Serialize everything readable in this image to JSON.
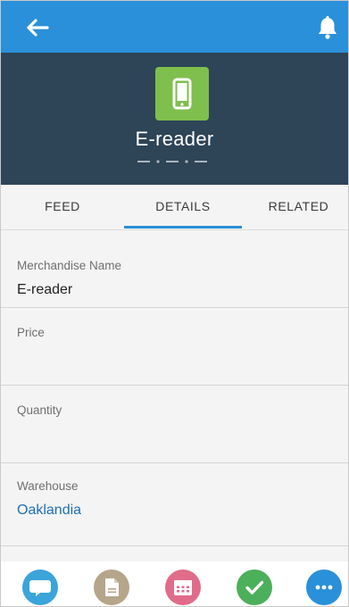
{
  "colors": {
    "topbar": "#2a90d9",
    "header": "#2e4457",
    "record_icon": "#7fbf4d",
    "tab_active_underline": "#2a90d9",
    "link": "#1f6fb5",
    "action_post": "#3ba4d9",
    "action_file": "#b5a58a",
    "action_event": "#e06c8a",
    "action_task": "#4caf5a",
    "action_more": "#2a90d9"
  },
  "topbar": {
    "back_icon": "arrow-left-icon",
    "bell_icon": "bell-icon"
  },
  "record": {
    "icon": "mobile-device-icon",
    "title": "E-reader",
    "pager_icon": "page-indicator-icon"
  },
  "tabs": {
    "feed": "FEED",
    "details": "DETAILS",
    "related": "RELATED",
    "active": "details"
  },
  "fields": [
    {
      "label": "Merchandise Name",
      "value": "E-reader"
    },
    {
      "label": "Price",
      "value": ""
    },
    {
      "label": "Quantity",
      "value": ""
    },
    {
      "label": "Warehouse",
      "value": "Oaklandia"
    }
  ],
  "actions": [
    {
      "icon": "chat-bubble-icon"
    },
    {
      "icon": "file-icon"
    },
    {
      "icon": "calendar-icon"
    },
    {
      "icon": "checkmark-icon"
    },
    {
      "icon": "more-icon"
    }
  ]
}
